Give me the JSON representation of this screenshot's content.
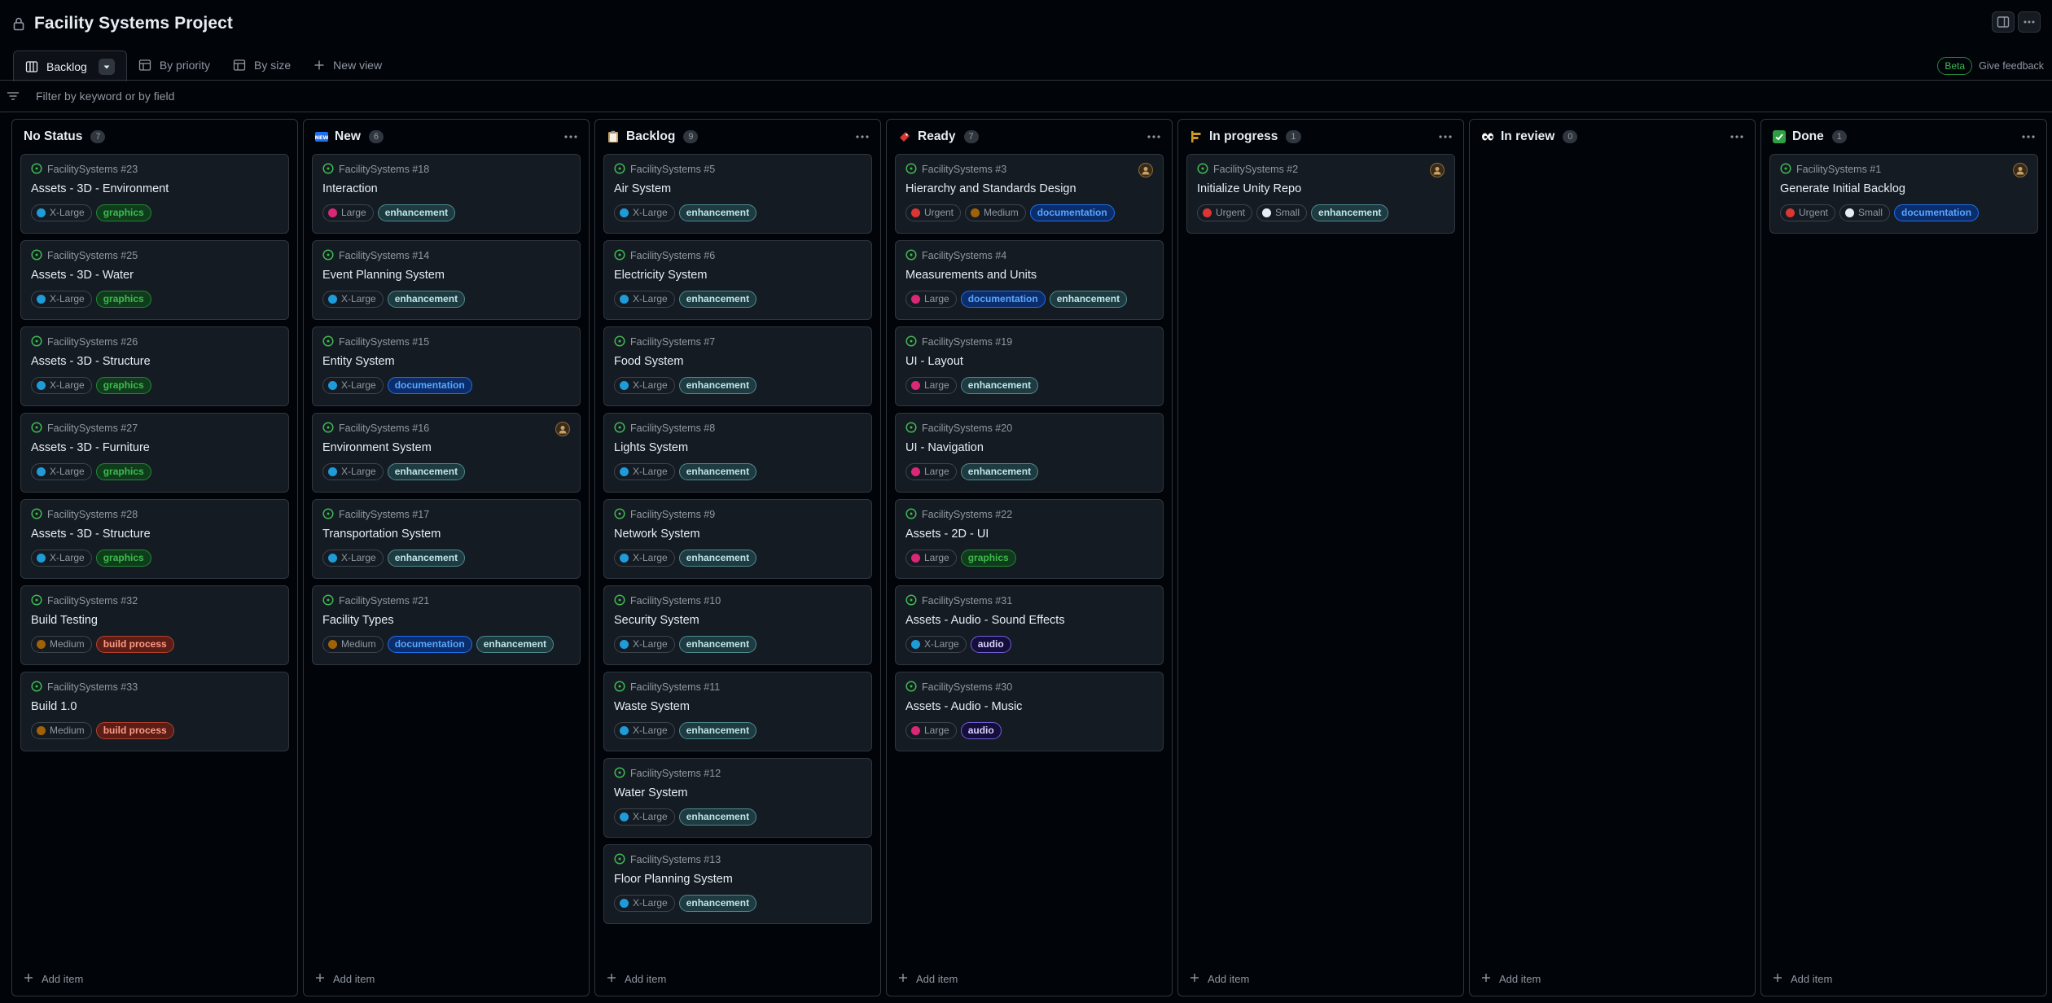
{
  "project": {
    "title": "Facility Systems Project"
  },
  "tabs": [
    {
      "label": "Backlog",
      "active": true
    },
    {
      "label": "By priority"
    },
    {
      "label": "By size"
    },
    {
      "label": "New view"
    }
  ],
  "feedback": {
    "badge": "Beta",
    "link": "Give feedback"
  },
  "filter": {
    "placeholder": "Filter by keyword or by field"
  },
  "colors": {
    "x_large": "#1f9bd8",
    "large": "#db2777",
    "medium": "#a16207",
    "small": "#e6edf3",
    "urgent": "#da3633"
  },
  "columns": [
    {
      "name": "No Status",
      "count": "7",
      "icon": "none",
      "add_label": "Add item",
      "cards": [
        {
          "ref": "FacilitySystems #23",
          "title": "Assets - 3D - Environment",
          "chips": [
            {
              "text": "X-Large",
              "icon": "x-large-icon"
            }
          ],
          "labels": [
            {
              "text": "graphics",
              "kind": "graphics"
            }
          ]
        },
        {
          "ref": "FacilitySystems #25",
          "title": "Assets - 3D - Water",
          "chips": [
            {
              "text": "X-Large",
              "icon": "x-large-icon"
            }
          ],
          "labels": [
            {
              "text": "graphics",
              "kind": "graphics"
            }
          ]
        },
        {
          "ref": "FacilitySystems #26",
          "title": "Assets - 3D - Structure",
          "chips": [
            {
              "text": "X-Large",
              "icon": "x-large-icon"
            }
          ],
          "labels": [
            {
              "text": "graphics",
              "kind": "graphics"
            }
          ]
        },
        {
          "ref": "FacilitySystems #27",
          "title": "Assets - 3D - Furniture",
          "chips": [
            {
              "text": "X-Large",
              "icon": "x-large-icon"
            }
          ],
          "labels": [
            {
              "text": "graphics",
              "kind": "graphics"
            }
          ]
        },
        {
          "ref": "FacilitySystems #28",
          "title": "Assets - 3D - Structure",
          "chips": [
            {
              "text": "X-Large",
              "icon": "x-large-icon"
            }
          ],
          "labels": [
            {
              "text": "graphics",
              "kind": "graphics"
            }
          ]
        },
        {
          "ref": "FacilitySystems #32",
          "title": "Build Testing",
          "chips": [
            {
              "text": "Medium",
              "icon": "medium-icon"
            }
          ],
          "labels": [
            {
              "text": "build process",
              "kind": "build"
            }
          ]
        },
        {
          "ref": "FacilitySystems #33",
          "title": "Build 1.0",
          "chips": [
            {
              "text": "Medium",
              "icon": "medium-icon"
            }
          ],
          "labels": [
            {
              "text": "build process",
              "kind": "build"
            }
          ]
        }
      ]
    },
    {
      "name": "New",
      "count": "6",
      "icon": "new-icon",
      "add_label": "Add item",
      "cards": [
        {
          "ref": "FacilitySystems #18",
          "title": "Interaction",
          "chips": [
            {
              "text": "Large",
              "icon": "large-icon"
            }
          ],
          "labels": [
            {
              "text": "enhancement",
              "kind": "enhancement"
            }
          ]
        },
        {
          "ref": "FacilitySystems #14",
          "title": "Event Planning System",
          "chips": [
            {
              "text": "X-Large",
              "icon": "x-large-icon"
            }
          ],
          "labels": [
            {
              "text": "enhancement",
              "kind": "enhancement"
            }
          ]
        },
        {
          "ref": "FacilitySystems #15",
          "title": "Entity System",
          "chips": [
            {
              "text": "X-Large",
              "icon": "x-large-icon"
            }
          ],
          "labels": [
            {
              "text": "documentation",
              "kind": "documentation"
            }
          ]
        },
        {
          "ref": "FacilitySystems #16",
          "title": "Environment System",
          "avatar": true,
          "chips": [
            {
              "text": "X-Large",
              "icon": "x-large-icon"
            }
          ],
          "labels": [
            {
              "text": "enhancement",
              "kind": "enhancement"
            }
          ]
        },
        {
          "ref": "FacilitySystems #17",
          "title": "Transportation System",
          "chips": [
            {
              "text": "X-Large",
              "icon": "x-large-icon"
            }
          ],
          "labels": [
            {
              "text": "enhancement",
              "kind": "enhancement"
            }
          ]
        },
        {
          "ref": "FacilitySystems #21",
          "title": "Facility Types",
          "chips": [
            {
              "text": "Medium",
              "icon": "medium-icon"
            }
          ],
          "labels": [
            {
              "text": "documentation",
              "kind": "documentation"
            },
            {
              "text": "enhancement",
              "kind": "enhancement"
            }
          ]
        }
      ]
    },
    {
      "name": "Backlog",
      "count": "9",
      "icon": "clipboard-icon",
      "add_label": "Add item",
      "cards": [
        {
          "ref": "FacilitySystems #5",
          "title": "Air System",
          "chips": [
            {
              "text": "X-Large",
              "icon": "x-large-icon"
            }
          ],
          "labels": [
            {
              "text": "enhancement",
              "kind": "enhancement"
            }
          ]
        },
        {
          "ref": "FacilitySystems #6",
          "title": "Electricity System",
          "chips": [
            {
              "text": "X-Large",
              "icon": "x-large-icon"
            }
          ],
          "labels": [
            {
              "text": "enhancement",
              "kind": "enhancement"
            }
          ]
        },
        {
          "ref": "FacilitySystems #7",
          "title": "Food System",
          "chips": [
            {
              "text": "X-Large",
              "icon": "x-large-icon"
            }
          ],
          "labels": [
            {
              "text": "enhancement",
              "kind": "enhancement"
            }
          ]
        },
        {
          "ref": "FacilitySystems #8",
          "title": "Lights System",
          "chips": [
            {
              "text": "X-Large",
              "icon": "x-large-icon"
            }
          ],
          "labels": [
            {
              "text": "enhancement",
              "kind": "enhancement"
            }
          ]
        },
        {
          "ref": "FacilitySystems #9",
          "title": "Network System",
          "chips": [
            {
              "text": "X-Large",
              "icon": "x-large-icon"
            }
          ],
          "labels": [
            {
              "text": "enhancement",
              "kind": "enhancement"
            }
          ]
        },
        {
          "ref": "FacilitySystems #10",
          "title": "Security System",
          "chips": [
            {
              "text": "X-Large",
              "icon": "x-large-icon"
            }
          ],
          "labels": [
            {
              "text": "enhancement",
              "kind": "enhancement"
            }
          ]
        },
        {
          "ref": "FacilitySystems #11",
          "title": "Waste System",
          "chips": [
            {
              "text": "X-Large",
              "icon": "x-large-icon"
            }
          ],
          "labels": [
            {
              "text": "enhancement",
              "kind": "enhancement"
            }
          ]
        },
        {
          "ref": "FacilitySystems #12",
          "title": "Water System",
          "chips": [
            {
              "text": "X-Large",
              "icon": "x-large-icon"
            }
          ],
          "labels": [
            {
              "text": "enhancement",
              "kind": "enhancement"
            }
          ]
        },
        {
          "ref": "FacilitySystems #13",
          "title": "Floor Planning System",
          "chips": [
            {
              "text": "X-Large",
              "icon": "x-large-icon"
            }
          ],
          "labels": [
            {
              "text": "enhancement",
              "kind": "enhancement"
            }
          ]
        }
      ]
    },
    {
      "name": "Ready",
      "count": "7",
      "icon": "ticket-icon",
      "add_label": "Add item",
      "cards": [
        {
          "ref": "FacilitySystems #3",
          "title": "Hierarchy and Standards Design",
          "avatar": true,
          "chips": [
            {
              "text": "Urgent",
              "icon": "urgent-icon"
            },
            {
              "text": "Medium",
              "icon": "medium-icon"
            }
          ],
          "labels": [
            {
              "text": "documentation",
              "kind": "documentation"
            }
          ]
        },
        {
          "ref": "FacilitySystems #4",
          "title": "Measurements and Units",
          "chips": [
            {
              "text": "Large",
              "icon": "large-icon"
            }
          ],
          "labels": [
            {
              "text": "documentation",
              "kind": "documentation"
            },
            {
              "text": "enhancement",
              "kind": "enhancement"
            }
          ]
        },
        {
          "ref": "FacilitySystems #19",
          "title": "UI - Layout",
          "chips": [
            {
              "text": "Large",
              "icon": "large-icon"
            }
          ],
          "labels": [
            {
              "text": "enhancement",
              "kind": "enhancement"
            }
          ]
        },
        {
          "ref": "FacilitySystems #20",
          "title": "UI - Navigation",
          "chips": [
            {
              "text": "Large",
              "icon": "large-icon"
            }
          ],
          "labels": [
            {
              "text": "enhancement",
              "kind": "enhancement"
            }
          ]
        },
        {
          "ref": "FacilitySystems #22",
          "title": "Assets - 2D - UI",
          "chips": [
            {
              "text": "Large",
              "icon": "large-icon"
            }
          ],
          "labels": [
            {
              "text": "graphics",
              "kind": "graphics"
            }
          ]
        },
        {
          "ref": "FacilitySystems #31",
          "title": "Assets - Audio - Sound Effects",
          "chips": [
            {
              "text": "X-Large",
              "icon": "x-large-icon"
            }
          ],
          "labels": [
            {
              "text": "audio",
              "kind": "audio"
            }
          ]
        },
        {
          "ref": "FacilitySystems #30",
          "title": "Assets - Audio - Music",
          "chips": [
            {
              "text": "Large",
              "icon": "large-icon"
            }
          ],
          "labels": [
            {
              "text": "audio",
              "kind": "audio"
            }
          ]
        }
      ]
    },
    {
      "name": "In progress",
      "count": "1",
      "icon": "construction-icon",
      "add_label": "Add item",
      "cards": [
        {
          "ref": "FacilitySystems #2",
          "title": "Initialize Unity Repo",
          "avatar": true,
          "chips": [
            {
              "text": "Urgent",
              "icon": "urgent-icon"
            },
            {
              "text": "Small",
              "icon": "small-icon"
            }
          ],
          "labels": [
            {
              "text": "enhancement",
              "kind": "enhancement"
            }
          ]
        }
      ]
    },
    {
      "name": "In review",
      "count": "0",
      "icon": "eyes-icon",
      "add_label": "Add item",
      "cards": []
    },
    {
      "name": "Done",
      "count": "1",
      "icon": "check-icon",
      "add_label": "Add item",
      "cards": [
        {
          "ref": "FacilitySystems #1",
          "title": "Generate Initial Backlog",
          "avatar": true,
          "chips": [
            {
              "text": "Urgent",
              "icon": "urgent-icon"
            },
            {
              "text": "Small",
              "icon": "small-icon"
            }
          ],
          "labels": [
            {
              "text": "documentation",
              "kind": "documentation"
            }
          ]
        }
      ]
    }
  ]
}
